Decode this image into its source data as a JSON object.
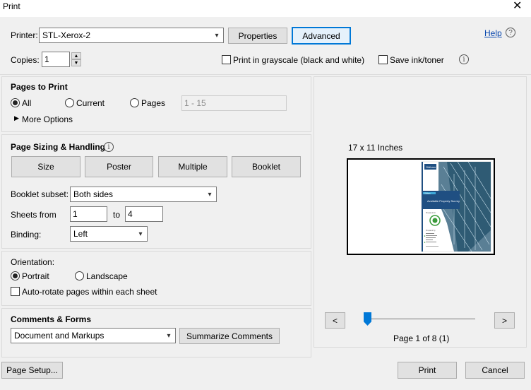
{
  "window": {
    "title": "Print",
    "close_glyph": "✕"
  },
  "printer": {
    "label": "Printer:",
    "selected": "STL-Xerox-2",
    "properties_label": "Properties",
    "advanced_label": "Advanced",
    "help_label": "Help",
    "help_glyph": "?"
  },
  "copies": {
    "label": "Copies:",
    "value": "1"
  },
  "options": {
    "grayscale_label": "Print in grayscale (black and white)",
    "save_ink_label": "Save ink/toner",
    "info_glyph": "i"
  },
  "pages_to_print": {
    "title": "Pages to Print",
    "all_label": "All",
    "current_label": "Current",
    "pages_label": "Pages",
    "pages_range_placeholder": "1 - 15",
    "more_options_label": "More Options",
    "selected": "All"
  },
  "sizing": {
    "title": "Page Sizing & Handling",
    "info_glyph": "i",
    "buttons": [
      "Size",
      "Poster",
      "Multiple",
      "Booklet"
    ],
    "booklet_subset_label": "Booklet subset:",
    "booklet_subset_value": "Both sides",
    "sheets_from_label": "Sheets from",
    "sheets_from_value": "1",
    "sheets_to_label": "to",
    "sheets_to_value": "4",
    "binding_label": "Binding:",
    "binding_value": "Left"
  },
  "orientation": {
    "title": "Orientation:",
    "portrait_label": "Portrait",
    "landscape_label": "Landscape",
    "selected": "Portrait",
    "auto_rotate_label": "Auto-rotate pages within each sheet"
  },
  "comments": {
    "title": "Comments & Forms",
    "selected": "Document and Markups",
    "summarize_label": "Summarize Comments"
  },
  "preview": {
    "paper_size": "17 x 11 Inches",
    "prev_glyph": "<",
    "next_glyph": ">",
    "page_status": "Page 1 of 8 (1)",
    "page_fraction": 0.0,
    "thumb_texts": {
      "logo": "Oldham",
      "tag": "Oldham",
      "headline": "Available Property Survey",
      "prepared_for": "Prepared for",
      "prepared_by": "Prepared by"
    }
  },
  "footer": {
    "page_setup_label": "Page Setup...",
    "print_label": "Print",
    "cancel_label": "Cancel"
  },
  "colors": {
    "accent": "#0078d7",
    "link": "#0645ad",
    "brochure_blue": "#1f4f82"
  }
}
